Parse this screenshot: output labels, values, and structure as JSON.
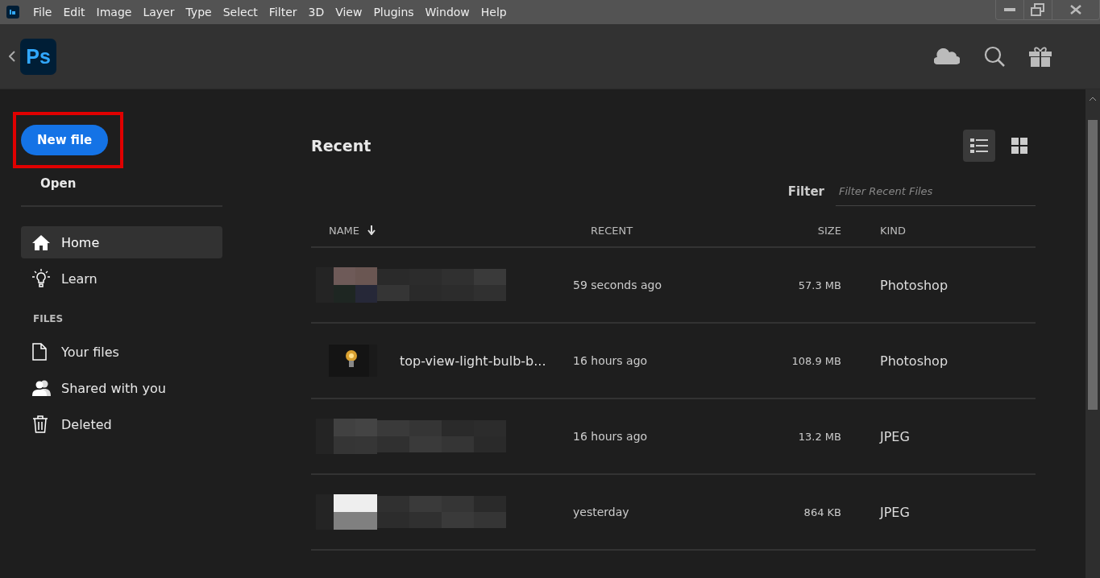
{
  "menu_bar": {
    "items": [
      "File",
      "Edit",
      "Image",
      "Layer",
      "Type",
      "Select",
      "Filter",
      "3D",
      "View",
      "Plugins",
      "Window",
      "Help"
    ]
  },
  "header": {
    "logo": "Ps"
  },
  "sidebar": {
    "new_file": {
      "label": "New file",
      "highlighted": true
    },
    "open": "Open",
    "nav": [
      {
        "label": "Home",
        "selected": true
      },
      {
        "label": "Learn",
        "selected": false
      }
    ],
    "files_heading": "FILES",
    "files": [
      {
        "label": "Your files",
        "selected": false
      },
      {
        "label": "Shared with you",
        "selected": false
      },
      {
        "label": "Deleted",
        "selected": false
      }
    ]
  },
  "recent": {
    "title": "Recent",
    "views": [
      {
        "selected": true
      },
      {
        "selected": false
      }
    ],
    "filter": {
      "label": "Filter",
      "placeholder": "Filter Recent Files"
    },
    "columns": [
      {
        "label": "NAME",
        "sorted": true
      },
      {
        "label": "RECENT",
        "sorted": false
      },
      {
        "label": "SIZE",
        "sorted": false
      },
      {
        "label": "KIND",
        "sorted": false
      }
    ],
    "rows": [
      {
        "name_hidden": true,
        "recent": "59 seconds ago",
        "size": "57.3 MB",
        "kind": "Photoshop"
      },
      {
        "name_hidden": false,
        "name": "top-view-light-bulb-b...",
        "recent": "16 hours ago",
        "size": "108.9 MB",
        "kind": "Photoshop"
      },
      {
        "name_hidden": true,
        "recent": "16 hours ago",
        "size": "13.2 MB",
        "kind": "JPEG"
      },
      {
        "name_hidden": true,
        "recent": "yesterday",
        "size": "864 KB",
        "kind": "JPEG"
      }
    ]
  }
}
